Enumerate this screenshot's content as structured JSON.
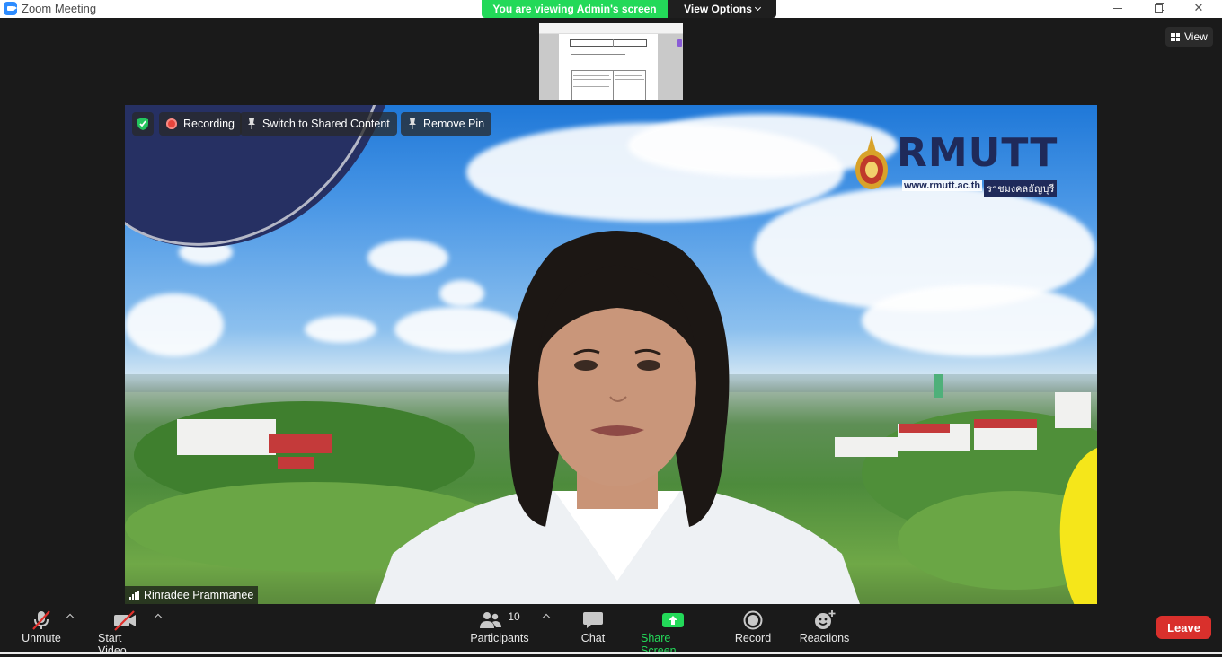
{
  "window": {
    "title": "Zoom Meeting",
    "controls": {
      "minimize": "minimize",
      "maximize": "restore",
      "close": "✕"
    }
  },
  "banner": {
    "status": "You are viewing Admin's screen",
    "options_label": "View Options"
  },
  "view_button": {
    "label": "View"
  },
  "video": {
    "overlay": {
      "recording_label": "Recording",
      "switch_label": "Switch to Shared Content",
      "remove_pin_label": "Remove Pin"
    },
    "participant_name": "Rinradee Prammanee",
    "logo": {
      "text": "RMUTT",
      "url": "www.rmutt.ac.th",
      "thai": "ราชมงคลธัญบุรี"
    }
  },
  "toolbar": {
    "unmute": "Unmute",
    "start_video": "Start Video",
    "participants": "Participants",
    "participants_count": "10",
    "chat": "Chat",
    "share_screen": "Share Screen",
    "record": "Record",
    "reactions": "Reactions",
    "leave": "Leave"
  },
  "colors": {
    "accent_green": "#23d959",
    "leave_red": "#d9302c",
    "zoom_blue": "#2d8cff",
    "background": "#1a1a1a"
  },
  "icons": [
    "zoom-icon",
    "shield-icon",
    "record-dot-icon",
    "pin-icon",
    "signal-icon",
    "mic-muted-icon",
    "video-off-icon",
    "participants-icon",
    "chat-icon",
    "share-screen-icon",
    "record-icon",
    "reactions-icon",
    "grid-view-icon",
    "chevron-down-icon",
    "caret-up-icon"
  ]
}
